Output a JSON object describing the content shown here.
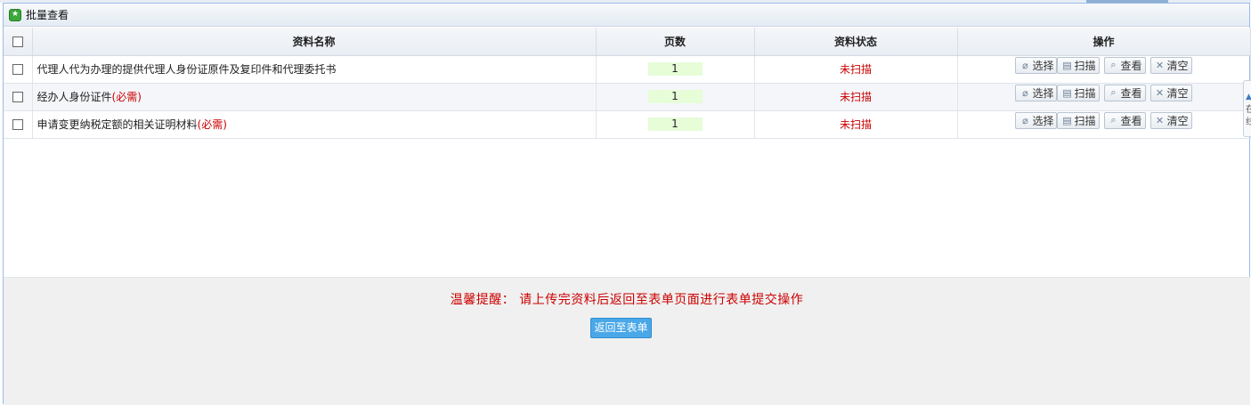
{
  "panel": {
    "title": "批量查看"
  },
  "table": {
    "headers": {
      "name": "资料名称",
      "pages": "页数",
      "status": "资料状态",
      "ops": "操作"
    },
    "rows": [
      {
        "name": "代理人代为办理的提供代理人身份证原件及复印件和代理委托书",
        "required_note": "",
        "pages": "1",
        "status": "未扫描"
      },
      {
        "name": "经办人身份证件",
        "required_note": "(必需)",
        "pages": "1",
        "status": "未扫描"
      },
      {
        "name": "申请变更纳税定额的相关证明材料",
        "required_note": "(必需)",
        "pages": "1",
        "status": "未扫描"
      }
    ],
    "actions": {
      "select": "选择",
      "scan": "扫描",
      "view": "查看",
      "clear": "清空"
    }
  },
  "footer": {
    "tip": "温馨提醒： 请上传完资料后返回至表单页面进行表单提交操作",
    "back_button": "返回至表单"
  },
  "side_tab": {
    "text": "在线"
  },
  "colors": {
    "required": "#cc0000",
    "status": "#cc0000",
    "page_bg": "#e6fdd8",
    "back_button": "#4aa8e8"
  }
}
